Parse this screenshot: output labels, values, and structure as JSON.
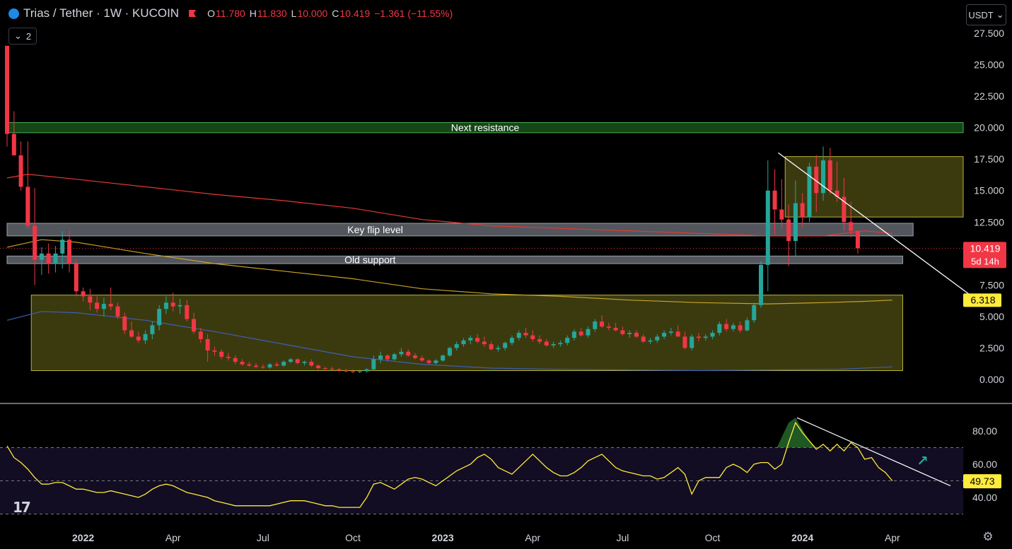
{
  "header": {
    "symbol_text": "Trias / Tether · 1W · KUCOIN",
    "ohlc": [
      {
        "key": "O",
        "value": "11.780"
      },
      {
        "key": "H",
        "value": "11.830"
      },
      {
        "key": "L",
        "value": "10.000"
      },
      {
        "key": "C",
        "value": "10.419"
      }
    ],
    "change": "−1.361 (−11.55%)",
    "collapse_count": "2",
    "currency_button": "USDT"
  },
  "colors": {
    "background": "#000000",
    "up": "#26a69a",
    "down": "#f23645",
    "ma_long": "#e53935",
    "ma_mid": "#c9a227",
    "ma_short": "#3f5fb5",
    "rsi_line": "#ffeb3b",
    "zone_yellow": "#6b6a1c",
    "zone_grey": "#787b86",
    "zone_green": "#1b5e20"
  },
  "icons": {
    "logo": "trias-logo-icon",
    "flag": "flag-icon",
    "chevron": "chevron-down-icon",
    "settings": "gear-icon",
    "tradingview": "tradingview-logo",
    "arrow": "arrow-up-right-icon"
  },
  "chart_data": [
    {
      "type": "candlestick",
      "title": "Trias / Tether · 1W · KUCOIN",
      "y_ticks": [
        "27.500",
        "25.000",
        "22.500",
        "20.000",
        "17.500",
        "15.000",
        "12.500",
        "7.500",
        "5.000",
        "2.500",
        "0.000"
      ],
      "ylim": [
        -1.0,
        28.5
      ],
      "x_ticks": [
        {
          "label": "2022",
          "idx": 11,
          "bold": true
        },
        {
          "label": "Apr",
          "idx": 24,
          "bold": false
        },
        {
          "label": "Jul",
          "idx": 37,
          "bold": false
        },
        {
          "label": "Oct",
          "idx": 50,
          "bold": false
        },
        {
          "label": "2023",
          "idx": 63,
          "bold": true
        },
        {
          "label": "Apr",
          "idx": 76,
          "bold": false
        },
        {
          "label": "Jul",
          "idx": 89,
          "bold": false
        },
        {
          "label": "Oct",
          "idx": 102,
          "bold": false
        },
        {
          "label": "2024",
          "idx": 115,
          "bold": true
        },
        {
          "label": "Apr",
          "idx": 128,
          "bold": false
        }
      ],
      "last_price_label": "10.419",
      "last_price_sub": "5d 14h",
      "last_price": 10.419,
      "ma_label": "6.318",
      "ma_value": 6.318,
      "zones": [
        {
          "label": "Next resistance",
          "y_top": 20.4,
          "y_bottom": 19.6,
          "idx_from": 0,
          "idx_to": 140,
          "kind": "green"
        },
        {
          "label": "Key flip level",
          "y_top": 12.4,
          "y_bottom": 11.4,
          "idx_from": 0,
          "idx_to": 131,
          "kind": "grey"
        },
        {
          "label": "Old support",
          "y_top": 9.8,
          "y_bottom": 9.2,
          "idx_from": 0,
          "idx_to": 129.5,
          "kind": "grey"
        },
        {
          "label": "",
          "y_top": 6.7,
          "y_bottom": 0.7,
          "idx_from": 3.5,
          "idx_to": 129.5,
          "kind": "yellow"
        },
        {
          "label": "",
          "y_top": 17.7,
          "y_bottom": 12.9,
          "idx_from": 112.5,
          "idx_to": 140,
          "kind": "yellow"
        }
      ],
      "trendline": {
        "from": {
          "idx": 111.5,
          "value": 18.0
        },
        "to": {
          "idx": 140,
          "value": 6.4
        }
      },
      "candles": [
        [
          26.5,
          26.5,
          18.5,
          19.5
        ],
        [
          19.5,
          21.3,
          17.8,
          17.8
        ],
        [
          17.8,
          18.9,
          15.0,
          15.3
        ],
        [
          15.3,
          18.9,
          12.0,
          12.2
        ],
        [
          12.2,
          15.2,
          7.5,
          9.5
        ],
        [
          9.5,
          10.5,
          8.3,
          10.0
        ],
        [
          10.0,
          10.8,
          8.4,
          9.2
        ],
        [
          9.2,
          10.6,
          8.5,
          10.0
        ],
        [
          10.0,
          11.8,
          8.8,
          11.1
        ],
        [
          11.1,
          11.8,
          8.5,
          9.2
        ],
        [
          9.2,
          9.5,
          6.6,
          7.0
        ],
        [
          7.0,
          7.3,
          6.2,
          6.6
        ],
        [
          6.6,
          7.2,
          5.5,
          6.1
        ],
        [
          6.1,
          6.6,
          5.3,
          5.6
        ],
        [
          5.6,
          6.5,
          5.0,
          6.0
        ],
        [
          6.0,
          7.3,
          5.5,
          5.8
        ],
        [
          5.8,
          6.1,
          4.8,
          5.0
        ],
        [
          5.0,
          5.3,
          3.6,
          3.9
        ],
        [
          3.9,
          4.6,
          3.3,
          3.4
        ],
        [
          3.4,
          3.8,
          2.9,
          3.1
        ],
        [
          3.1,
          3.9,
          2.8,
          3.6
        ],
        [
          3.6,
          4.6,
          3.2,
          4.3
        ],
        [
          4.3,
          5.9,
          3.9,
          5.6
        ],
        [
          5.6,
          6.6,
          5.2,
          6.1
        ],
        [
          6.1,
          6.9,
          5.4,
          5.8
        ],
        [
          5.8,
          6.4,
          5.2,
          5.9
        ],
        [
          5.9,
          6.3,
          4.6,
          4.8
        ],
        [
          4.8,
          5.3,
          3.6,
          3.8
        ],
        [
          3.8,
          4.1,
          2.9,
          3.2
        ],
        [
          3.2,
          3.6,
          1.4,
          2.3
        ],
        [
          2.3,
          2.6,
          1.9,
          2.2
        ],
        [
          2.2,
          2.4,
          1.6,
          1.8
        ],
        [
          1.8,
          2.1,
          1.5,
          1.7
        ],
        [
          1.7,
          1.9,
          1.2,
          1.4
        ],
        [
          1.4,
          1.6,
          1.1,
          1.2
        ],
        [
          1.2,
          1.4,
          1.0,
          1.1
        ],
        [
          1.1,
          1.3,
          0.9,
          1.0
        ],
        [
          1.0,
          1.2,
          0.85,
          0.95
        ],
        [
          0.95,
          1.3,
          0.85,
          1.2
        ],
        [
          1.2,
          1.4,
          1.0,
          1.1
        ],
        [
          1.1,
          1.5,
          1.0,
          1.4
        ],
        [
          1.4,
          1.7,
          1.3,
          1.6
        ],
        [
          1.6,
          1.7,
          1.2,
          1.3
        ],
        [
          1.3,
          1.5,
          1.1,
          1.4
        ],
        [
          1.4,
          1.6,
          1.0,
          1.1
        ],
        [
          1.1,
          1.2,
          0.8,
          0.9
        ],
        [
          0.9,
          1.0,
          0.75,
          0.85
        ],
        [
          0.85,
          1.0,
          0.7,
          0.8
        ],
        [
          0.8,
          0.9,
          0.6,
          0.7
        ],
        [
          0.7,
          0.85,
          0.55,
          0.65
        ],
        [
          0.65,
          0.8,
          0.5,
          0.6
        ],
        [
          0.6,
          0.75,
          0.5,
          0.65
        ],
        [
          0.65,
          0.9,
          0.55,
          0.8
        ],
        [
          0.8,
          1.9,
          0.7,
          1.6
        ],
        [
          1.6,
          2.2,
          1.3,
          1.9
        ],
        [
          1.9,
          2.0,
          1.4,
          1.6
        ],
        [
          1.6,
          2.1,
          1.5,
          2.0
        ],
        [
          2.0,
          2.5,
          1.8,
          2.2
        ],
        [
          2.2,
          2.4,
          1.8,
          1.9
        ],
        [
          1.9,
          2.1,
          1.6,
          1.7
        ],
        [
          1.7,
          1.9,
          1.4,
          1.5
        ],
        [
          1.5,
          1.6,
          1.2,
          1.3
        ],
        [
          1.3,
          1.6,
          1.2,
          1.5
        ],
        [
          1.5,
          2.0,
          1.4,
          1.9
        ],
        [
          1.9,
          2.6,
          1.8,
          2.5
        ],
        [
          2.5,
          3.0,
          2.3,
          2.8
        ],
        [
          2.8,
          3.3,
          2.6,
          3.1
        ],
        [
          3.1,
          3.5,
          2.8,
          3.3
        ],
        [
          3.3,
          3.6,
          2.9,
          3.0
        ],
        [
          3.0,
          3.4,
          2.6,
          2.8
        ],
        [
          2.8,
          3.0,
          2.3,
          2.4
        ],
        [
          2.4,
          2.7,
          2.2,
          2.5
        ],
        [
          2.5,
          3.0,
          2.3,
          2.9
        ],
        [
          2.9,
          3.5,
          2.7,
          3.3
        ],
        [
          3.3,
          3.9,
          3.1,
          3.7
        ],
        [
          3.7,
          4.1,
          3.3,
          3.5
        ],
        [
          3.5,
          3.9,
          3.0,
          3.2
        ],
        [
          3.2,
          3.5,
          2.8,
          3.0
        ],
        [
          3.0,
          3.2,
          2.6,
          2.7
        ],
        [
          2.7,
          3.0,
          2.5,
          2.8
        ],
        [
          2.8,
          3.1,
          2.6,
          2.9
        ],
        [
          2.9,
          3.5,
          2.7,
          3.3
        ],
        [
          3.3,
          4.0,
          3.1,
          3.8
        ],
        [
          3.8,
          4.1,
          3.4,
          3.5
        ],
        [
          3.5,
          4.2,
          3.3,
          4.0
        ],
        [
          4.0,
          4.8,
          3.8,
          4.6
        ],
        [
          4.6,
          5.1,
          4.1,
          4.2
        ],
        [
          4.2,
          4.5,
          3.9,
          4.1
        ],
        [
          4.1,
          4.5,
          3.8,
          3.9
        ],
        [
          3.9,
          4.2,
          3.5,
          3.6
        ],
        [
          3.6,
          3.9,
          3.3,
          3.7
        ],
        [
          3.7,
          3.9,
          3.3,
          3.4
        ],
        [
          3.4,
          3.6,
          2.9,
          3.0
        ],
        [
          3.0,
          3.3,
          2.8,
          3.1
        ],
        [
          3.1,
          3.6,
          2.9,
          3.4
        ],
        [
          3.4,
          3.9,
          3.2,
          3.7
        ],
        [
          3.7,
          4.1,
          3.5,
          3.8
        ],
        [
          3.8,
          4.3,
          3.6,
          3.4
        ],
        [
          3.4,
          3.8,
          2.4,
          2.5
        ],
        [
          2.5,
          3.6,
          2.3,
          3.4
        ],
        [
          3.4,
          3.7,
          3.0,
          3.3
        ],
        [
          3.3,
          3.6,
          3.1,
          3.4
        ],
        [
          3.4,
          3.9,
          3.2,
          3.7
        ],
        [
          3.7,
          4.6,
          3.5,
          4.4
        ],
        [
          4.4,
          4.8,
          3.8,
          4.0
        ],
        [
          4.0,
          4.5,
          3.8,
          4.3
        ],
        [
          4.3,
          4.6,
          3.7,
          3.9
        ],
        [
          3.9,
          4.9,
          3.8,
          4.7
        ],
        [
          4.7,
          6.1,
          4.5,
          5.9
        ],
        [
          5.9,
          9.4,
          5.7,
          9.1
        ],
        [
          9.1,
          17.4,
          7.0,
          15.0
        ],
        [
          15.0,
          16.7,
          11.5,
          13.5
        ],
        [
          13.5,
          15.9,
          12.0,
          12.7
        ],
        [
          12.7,
          13.9,
          9.0,
          11.0
        ],
        [
          11.0,
          15.8,
          9.8,
          14.0
        ],
        [
          14.0,
          14.8,
          12.1,
          12.9
        ],
        [
          12.9,
          17.2,
          12.5,
          16.9
        ],
        [
          16.9,
          17.8,
          13.3,
          14.8
        ],
        [
          14.8,
          18.5,
          14.2,
          17.4
        ],
        [
          17.4,
          18.4,
          14.7,
          15.0
        ],
        [
          15.0,
          17.3,
          14.1,
          14.5
        ],
        [
          14.5,
          16.0,
          11.8,
          12.5
        ],
        [
          12.5,
          14.1,
          11.3,
          11.8
        ],
        [
          11.8,
          11.83,
          10.0,
          10.419
        ]
      ],
      "ma_long_path": [
        [
          0,
          16.0
        ],
        [
          3,
          16.3
        ],
        [
          10,
          15.9
        ],
        [
          20,
          15.3
        ],
        [
          30,
          14.7
        ],
        [
          40,
          14.2
        ],
        [
          50,
          13.6
        ],
        [
          60,
          12.7
        ],
        [
          70,
          12.2
        ],
        [
          80,
          12.0
        ],
        [
          90,
          11.8
        ],
        [
          100,
          11.6
        ],
        [
          110,
          11.4
        ],
        [
          118,
          11.4
        ],
        [
          124,
          11.8
        ],
        [
          128,
          11.6
        ]
      ],
      "ma_mid_path": [
        [
          0,
          10.5
        ],
        [
          5,
          11.1
        ],
        [
          10,
          10.9
        ],
        [
          20,
          10.0
        ],
        [
          30,
          9.2
        ],
        [
          40,
          8.6
        ],
        [
          50,
          8.0
        ],
        [
          60,
          7.2
        ],
        [
          70,
          6.8
        ],
        [
          80,
          6.6
        ],
        [
          90,
          6.3
        ],
        [
          100,
          6.1
        ],
        [
          110,
          6.0
        ],
        [
          118,
          6.1
        ],
        [
          124,
          6.2
        ],
        [
          128,
          6.3
        ]
      ],
      "ma_short_path": [
        [
          0,
          4.7
        ],
        [
          5,
          5.4
        ],
        [
          10,
          5.3
        ],
        [
          20,
          4.7
        ],
        [
          30,
          3.8
        ],
        [
          40,
          2.8
        ],
        [
          50,
          1.8
        ],
        [
          60,
          1.2
        ],
        [
          70,
          0.9
        ],
        [
          80,
          0.8
        ],
        [
          90,
          0.75
        ],
        [
          100,
          0.7
        ],
        [
          110,
          0.75
        ],
        [
          120,
          0.8
        ],
        [
          128,
          1.0
        ]
      ]
    },
    {
      "type": "line",
      "title": "",
      "y_ticks": [
        "80.00",
        "60.00",
        "40.00"
      ],
      "ylim": [
        29,
        90
      ],
      "levels": [
        30,
        50,
        70
      ],
      "last_label": "49.73",
      "last_value": 49.73,
      "trendline": {
        "from": {
          "idx": 114.2,
          "value": 88.0
        },
        "to": {
          "idx": 136.4,
          "value": 47.0
        }
      },
      "rsi": [
        71,
        64,
        61,
        57,
        52,
        48,
        48,
        49,
        49,
        47,
        45,
        45,
        44,
        43,
        43,
        44,
        43,
        42,
        41,
        40,
        42,
        45,
        47,
        48,
        47,
        45,
        43,
        42,
        41,
        40,
        38,
        37,
        36,
        35,
        35,
        35,
        35,
        35,
        35,
        36,
        37,
        38,
        38,
        38,
        37,
        36,
        35,
        35,
        34,
        34,
        34,
        34,
        40,
        48,
        49,
        47,
        45,
        48,
        51,
        52,
        51,
        49,
        47,
        50,
        53,
        56,
        58,
        60,
        64,
        66,
        63,
        58,
        56,
        54,
        58,
        62,
        66,
        62,
        58,
        55,
        53,
        53,
        55,
        58,
        62,
        64,
        66,
        62,
        58,
        56,
        55,
        54,
        53,
        53,
        51,
        52,
        55,
        58,
        54,
        42,
        50,
        52,
        52,
        52,
        58,
        60,
        58,
        55,
        60,
        61,
        61,
        57,
        60,
        73,
        85,
        79,
        74,
        69,
        72,
        68,
        72,
        68,
        73,
        70,
        63,
        64,
        58,
        55,
        50
      ]
    }
  ]
}
